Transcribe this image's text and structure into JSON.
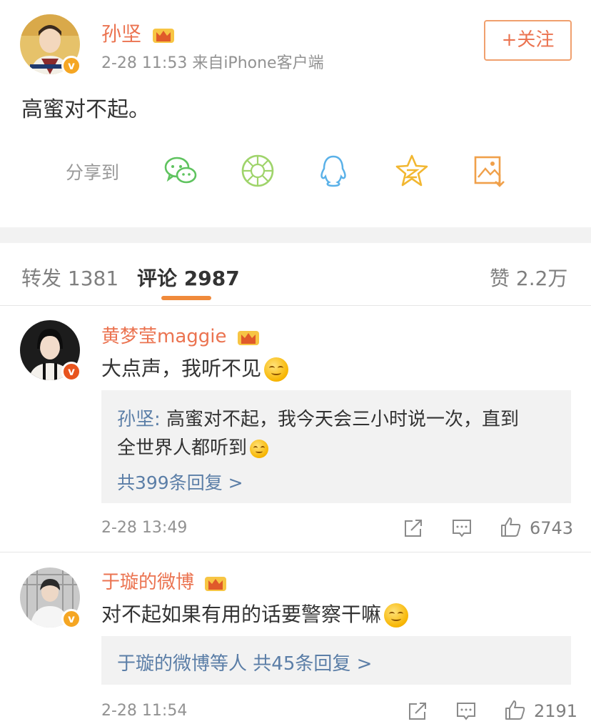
{
  "post": {
    "author": "孙坚",
    "meta": "2-28 11:53  来自iPhone客户端",
    "follow_label": "+关注",
    "text": "高蜜对不起。",
    "share_label": "分享到",
    "share_icons": [
      "wechat-icon",
      "moments-icon",
      "qq-icon",
      "qzone-icon",
      "save-image-icon"
    ]
  },
  "tabs": {
    "repost": "转发 1381",
    "comments": "评论 2987",
    "likes": "赞 2.2万"
  },
  "comments": [
    {
      "author": "黄梦莹maggie",
      "text": "大点声，我听不见",
      "reply": {
        "user": "孙坚:",
        "line1": " 高蜜对不起，我今天会三小时说一次，直到",
        "line2": "全世界人都听到",
        "more": "共399条回复 >"
      },
      "time": "2-28 13:49",
      "likes": "6743"
    },
    {
      "author": "于璇的微博",
      "text": "对不起如果有用的话要警察干嘛",
      "reply": {
        "user": "于璇的微博等人",
        "more": " 共45条回复 >"
      },
      "time": "2-28 11:54",
      "likes": "2191"
    }
  ],
  "colors": {
    "name_orange": "#eb7350",
    "link_blue": "#5b7ea7",
    "accent": "#f08a3b",
    "badge_red": "#e8541e",
    "badge_gold": "#f5a623"
  }
}
